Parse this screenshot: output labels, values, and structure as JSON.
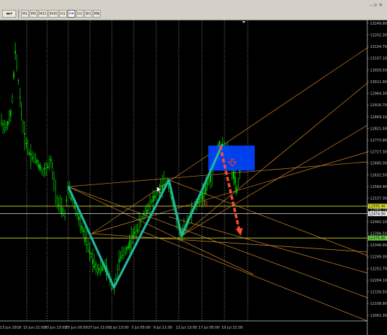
{
  "toolbar": {
    "timeframes": [
      {
        "label": "M1",
        "active": false
      },
      {
        "label": "M5",
        "active": false
      },
      {
        "label": "M15",
        "active": false
      },
      {
        "label": "M30",
        "active": false
      },
      {
        "label": "H1",
        "active": false
      },
      {
        "label": "H4",
        "active": true
      },
      {
        "label": "D1",
        "active": false
      },
      {
        "label": "W1",
        "active": false
      },
      {
        "label": "MN",
        "active": false
      }
    ],
    "window_controls": "– ▫ ×"
  },
  "colors": {
    "background": "#000000",
    "candle": "#00cc00",
    "zigzag": "#1fb8a0",
    "fan_lines": "#d88a2a",
    "hline": "#d8d82a",
    "arrow": "#ff4d2e",
    "zone": "#0044ff",
    "vgrid": "#ffffff"
  },
  "chart_data": {
    "type": "candlestick",
    "timeframe": "H4",
    "y_axis": {
      "ticks": [
        "13249.90",
        "13202.30",
        "13154.70",
        "13107.10",
        "13059.50",
        "13011.90",
        "12964.30",
        "12916.70",
        "12869.10",
        "12821.50",
        "12773.90",
        "12727.30",
        "12680.30",
        "12632.50",
        "12584.90",
        "12537.30",
        "12489.70",
        "12442.10",
        "12394.50",
        "12346.90",
        "12299.30",
        "12251.70",
        "12204.10",
        "12156.50",
        "12108.90",
        "12061.30"
      ],
      "price_tags": [
        {
          "label": "12505.40",
          "kind": "hline"
        },
        {
          "label": "12474.90",
          "kind": "hline"
        },
        {
          "label": "12375.80",
          "kind": "hline"
        }
      ]
    },
    "x_axis": {
      "labels": [
        "13 Jun 2018",
        "15 Jun 21:00",
        "20 Jun 13:00",
        "25 Jun 05:00",
        "27 Jun 21:00",
        "2 Jul 13:00",
        "5 Jul 05:00",
        "9 Jul 21:00",
        "12 Jul 13:00",
        "17 Jul 05:00",
        "19 Jul 21:00"
      ]
    },
    "zigzag_points": [
      {
        "time": "22 Jun",
        "price": 12585
      },
      {
        "time": "29 Jun",
        "price": 12175
      },
      {
        "time": "5 Jul",
        "price": 12612
      },
      {
        "time": "9 Jul",
        "price": 12385
      },
      {
        "time": "16 Jul",
        "price": 12757
      }
    ],
    "forecast_arrow": {
      "from_price": 12750,
      "to_price": 12385
    },
    "zone": {
      "top_price": 12752,
      "bottom_price": 12650
    }
  }
}
